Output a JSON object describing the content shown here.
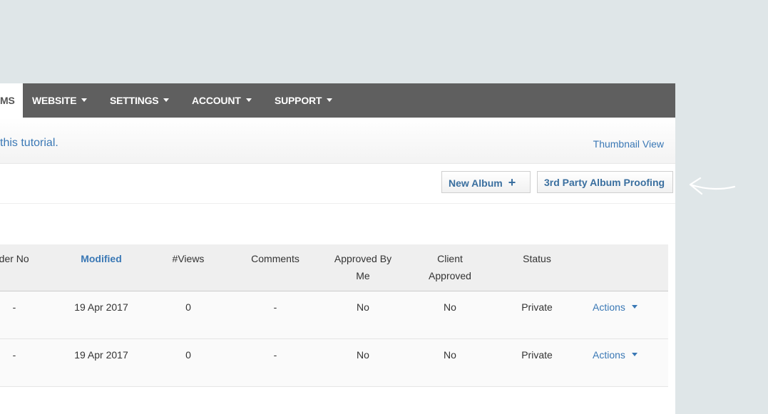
{
  "nav": {
    "items": [
      {
        "label": "MS",
        "active": true,
        "caret": false
      },
      {
        "label": "WEBSITE",
        "active": false,
        "caret": true
      },
      {
        "label": "SETTINGS",
        "active": false,
        "caret": true
      },
      {
        "label": "ACCOUNT",
        "active": false,
        "caret": true
      },
      {
        "label": "SUPPORT",
        "active": false,
        "caret": true
      }
    ]
  },
  "info": {
    "tutorial_text": "this tutorial.",
    "thumbnail_view": "Thumbnail View"
  },
  "toolbar": {
    "new_album": "New Album",
    "new_album_icon": "plus-icon",
    "third_party": "3rd Party Album Proofing"
  },
  "table": {
    "headers": {
      "order_no": "rder No",
      "modified": "Modified",
      "views": "#Views",
      "comments": "Comments",
      "approved_by_me_1": "Approved By",
      "approved_by_me_2": "Me",
      "client_approved_1": "Client",
      "client_approved_2": "Approved",
      "status": "Status"
    },
    "rows": [
      {
        "order_no": "-",
        "modified": "19 Apr 2017",
        "views": "0",
        "comments": "-",
        "approved_by_me": "No",
        "client_approved": "No",
        "status": "Private",
        "actions": "Actions"
      },
      {
        "order_no": "-",
        "modified": "19 Apr 2017",
        "views": "0",
        "comments": "-",
        "approved_by_me": "No",
        "client_approved": "No",
        "status": "Private",
        "actions": "Actions"
      }
    ]
  },
  "colors": {
    "nav_bg": "#5f5f5f",
    "link": "#3a78b5",
    "page_bg": "#dfe6e8"
  }
}
